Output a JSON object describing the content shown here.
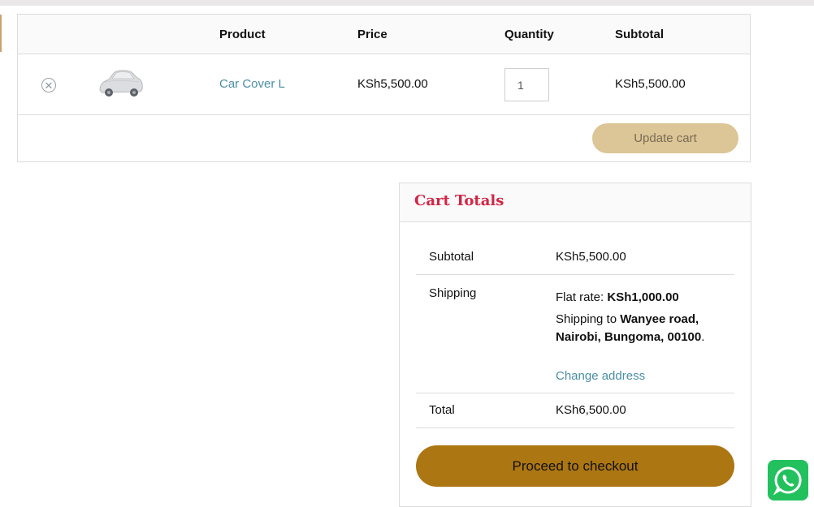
{
  "cart": {
    "headers": {
      "product": "Product",
      "price": "Price",
      "quantity": "Quantity",
      "subtotal": "Subtotal"
    },
    "items": [
      {
        "product_name": "Car Cover L",
        "price": "KSh5,500.00",
        "quantity": "1",
        "subtotal": "KSh5,500.00",
        "remove_icon": "close-circle-icon",
        "thumbnail": "car-cover-image"
      }
    ],
    "update_label": "Update cart"
  },
  "totals": {
    "title": "Cart Totals",
    "subtotal_label": "Subtotal",
    "subtotal_value": "KSh5,500.00",
    "shipping_label": "Shipping",
    "shipping_method_prefix": "Flat rate: ",
    "shipping_rate": "KSh1,000.00",
    "shipping_to_prefix": "Shipping to ",
    "shipping_address": "Wanyee road, Nairobi, Bungoma, 00100",
    "shipping_address_suffix": ".",
    "change_address": "Change address",
    "total_label": "Total",
    "total_value": "KSh6,500.00",
    "checkout_label": "Proceed to checkout"
  },
  "widgets": {
    "whatsapp_icon": "whatsapp-icon"
  },
  "colors": {
    "accent_link": "#4a8ea4",
    "title_red": "#d32545",
    "update_button": "#dcc596",
    "checkout_button": "#ac7612",
    "whatsapp_green": "#22c15e"
  }
}
